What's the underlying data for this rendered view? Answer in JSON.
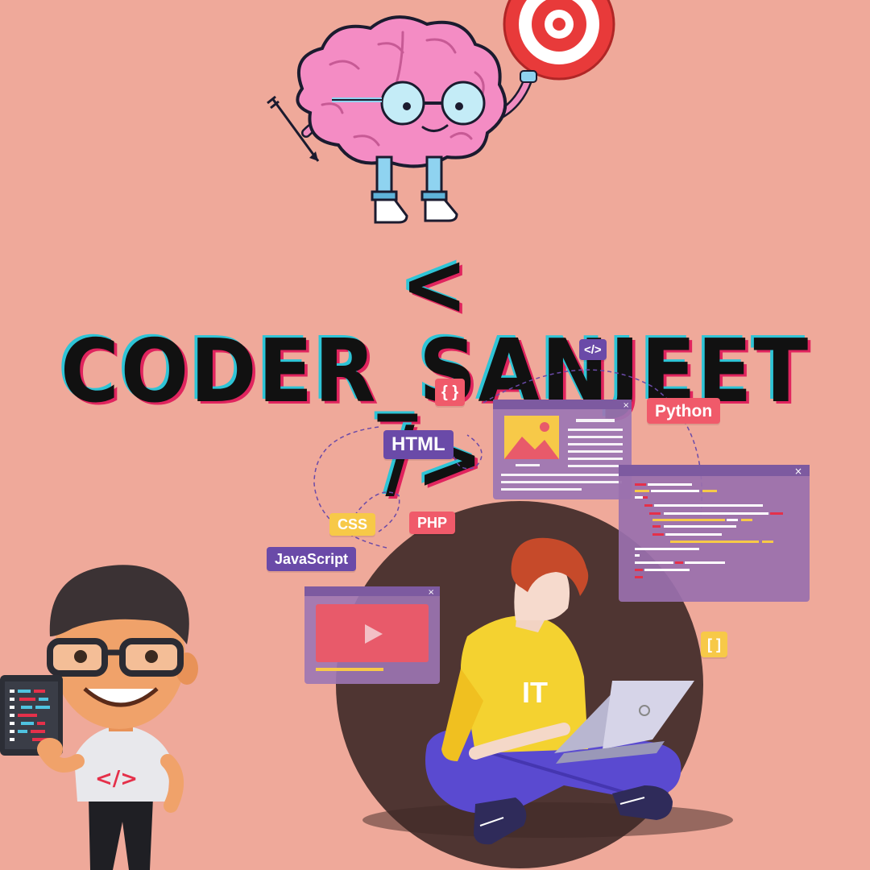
{
  "title": "< CODER_SANJEET />",
  "tags": {
    "code": "</>",
    "braces": "{ }",
    "python": "Python",
    "html": "HTML",
    "css": "CSS",
    "php": "PHP",
    "javascript": "JavaScript",
    "brackets": "[ ]"
  },
  "shirt_text": "IT",
  "tablet_shirt_icon": "</>",
  "colors": {
    "background": "#efa99a",
    "title": "#111111",
    "title_shadow_cyan": "#2ec4d6",
    "title_shadow_pink": "#e0245e",
    "tag_purple": "#6a4aa8",
    "tag_red": "#f05a6a",
    "tag_yellow": "#f7c948"
  }
}
